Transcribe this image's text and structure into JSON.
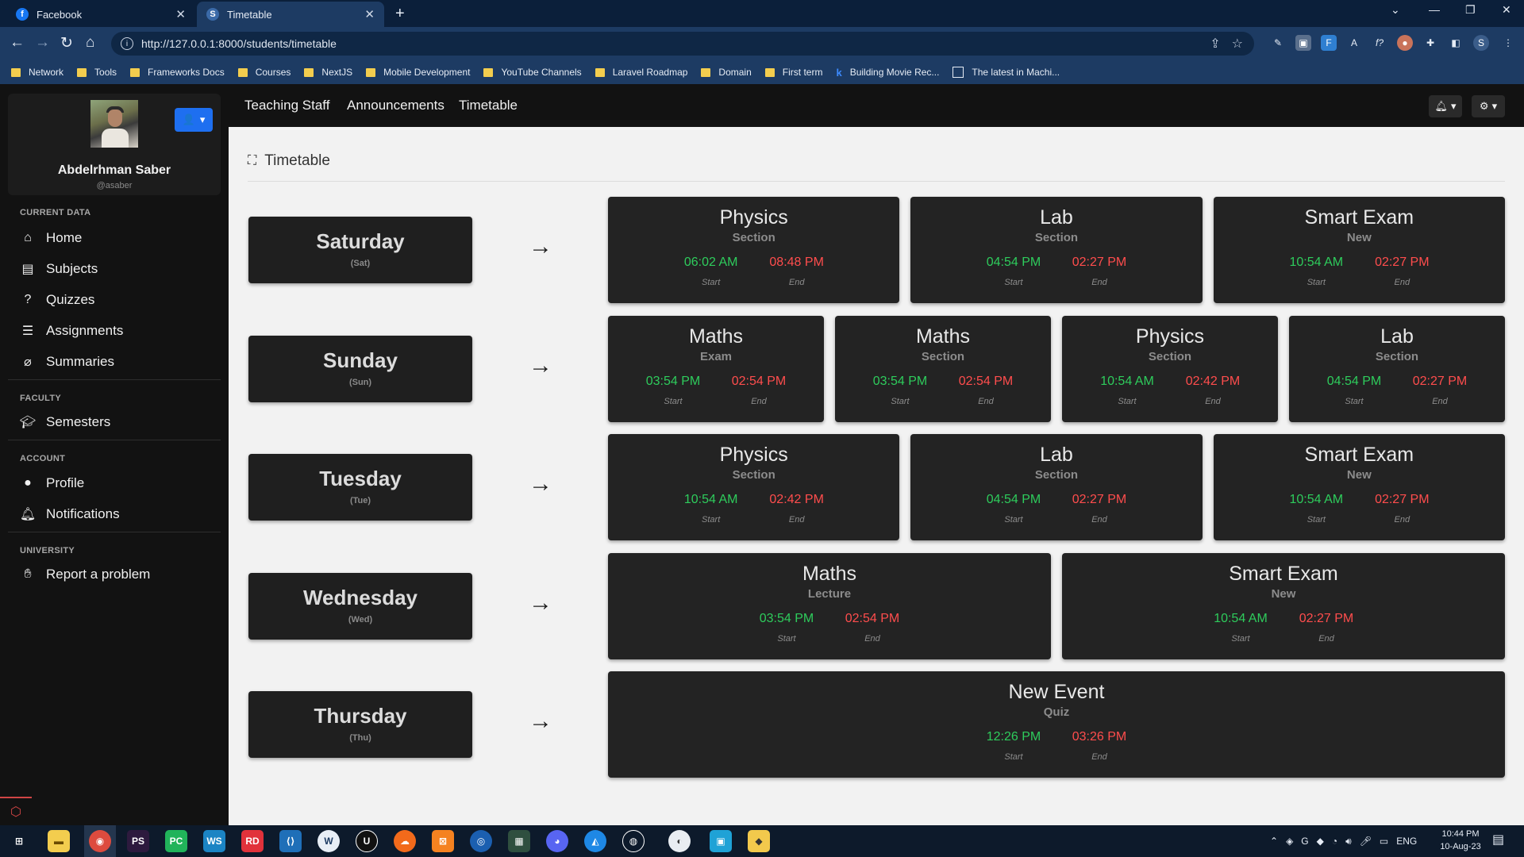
{
  "browser": {
    "tabs": [
      {
        "title": "Facebook",
        "favicon": "facebook-icon"
      },
      {
        "title": "Timetable",
        "favicon": "page-icon"
      }
    ],
    "url": "http://127.0.0.1:8000/students/timetable",
    "bookmarks": [
      {
        "label": "Network",
        "icon": "folder-icon"
      },
      {
        "label": "Tools",
        "icon": "folder-icon"
      },
      {
        "label": "Frameworks Docs",
        "icon": "folder-icon"
      },
      {
        "label": "Courses",
        "icon": "folder-icon"
      },
      {
        "label": "NextJS",
        "icon": "folder-icon"
      },
      {
        "label": "Mobile Development",
        "icon": "folder-icon"
      },
      {
        "label": "YouTube Channels",
        "icon": "folder-icon"
      },
      {
        "label": "Laravel Roadmap",
        "icon": "folder-icon"
      },
      {
        "label": "Domain",
        "icon": "folder-icon"
      },
      {
        "label": "First term",
        "icon": "folder-icon"
      },
      {
        "label": "Building Movie Rec...",
        "icon": "k-icon"
      },
      {
        "label": "The latest in Machi...",
        "icon": "image-icon"
      }
    ]
  },
  "user": {
    "name": "Abdelrhman Saber",
    "handle": "@asaber"
  },
  "sidebar": {
    "sections": [
      {
        "title": "CURRENT DATA",
        "items": [
          {
            "label": "Home",
            "icon": "home-icon"
          },
          {
            "label": "Subjects",
            "icon": "book-icon"
          },
          {
            "label": "Quizzes",
            "icon": "question-icon"
          },
          {
            "label": "Assignments",
            "icon": "list-icon"
          },
          {
            "label": "Summaries",
            "icon": "paperclip-icon"
          }
        ]
      },
      {
        "title": "FACULTY",
        "items": [
          {
            "label": "Semesters",
            "icon": "graduation-cap-icon"
          }
        ]
      },
      {
        "title": "ACCOUNT",
        "items": [
          {
            "label": "Profile",
            "icon": "user-icon"
          },
          {
            "label": "Notifications",
            "icon": "bell-icon"
          }
        ]
      },
      {
        "title": "UNIVERSITY",
        "items": [
          {
            "label": "Report a problem",
            "icon": "hand-icon"
          }
        ]
      }
    ]
  },
  "topnav": {
    "links": [
      "Teaching Staff",
      "Announcements",
      "Timetable"
    ]
  },
  "page": {
    "heading": "Timetable"
  },
  "timetable": {
    "start_label": "Start",
    "end_label": "End",
    "days": [
      {
        "name": "Saturday",
        "abbr": "(Sat)",
        "events": [
          {
            "title": "Physics",
            "type": "Section",
            "start": "06:02 AM",
            "end": "08:48 PM"
          },
          {
            "title": "Lab",
            "type": "Section",
            "start": "04:54 PM",
            "end": "02:27 PM"
          },
          {
            "title": "Smart Exam",
            "type": "New",
            "start": "10:54 AM",
            "end": "02:27 PM"
          }
        ]
      },
      {
        "name": "Sunday",
        "abbr": "(Sun)",
        "events": [
          {
            "title": "Maths",
            "type": "Exam",
            "start": "03:54 PM",
            "end": "02:54 PM"
          },
          {
            "title": "Maths",
            "type": "Section",
            "start": "03:54 PM",
            "end": "02:54 PM"
          },
          {
            "title": "Physics",
            "type": "Section",
            "start": "10:54 AM",
            "end": "02:42 PM"
          },
          {
            "title": "Lab",
            "type": "Section",
            "start": "04:54 PM",
            "end": "02:27 PM"
          }
        ]
      },
      {
        "name": "Tuesday",
        "abbr": "(Tue)",
        "events": [
          {
            "title": "Physics",
            "type": "Section",
            "start": "10:54 AM",
            "end": "02:42 PM"
          },
          {
            "title": "Lab",
            "type": "Section",
            "start": "04:54 PM",
            "end": "02:27 PM"
          },
          {
            "title": "Smart Exam",
            "type": "New",
            "start": "10:54 AM",
            "end": "02:27 PM"
          }
        ]
      },
      {
        "name": "Wednesday",
        "abbr": "(Wed)",
        "events": [
          {
            "title": "Maths",
            "type": "Lecture",
            "start": "03:54 PM",
            "end": "02:54 PM"
          },
          {
            "title": "Smart Exam",
            "type": "New",
            "start": "10:54 AM",
            "end": "02:27 PM"
          }
        ]
      },
      {
        "name": "Thursday",
        "abbr": "(Thu)",
        "events": [
          {
            "title": "New Event",
            "type": "Quiz",
            "start": "12:26 PM",
            "end": "03:26 PM"
          }
        ]
      }
    ]
  },
  "system": {
    "language": "ENG",
    "time": "10:44 PM",
    "date": "10-Aug-23"
  },
  "colors": {
    "start_time": "#2ecc5c",
    "end_time": "#ff4d4d",
    "accent": "#1e6ff0"
  }
}
